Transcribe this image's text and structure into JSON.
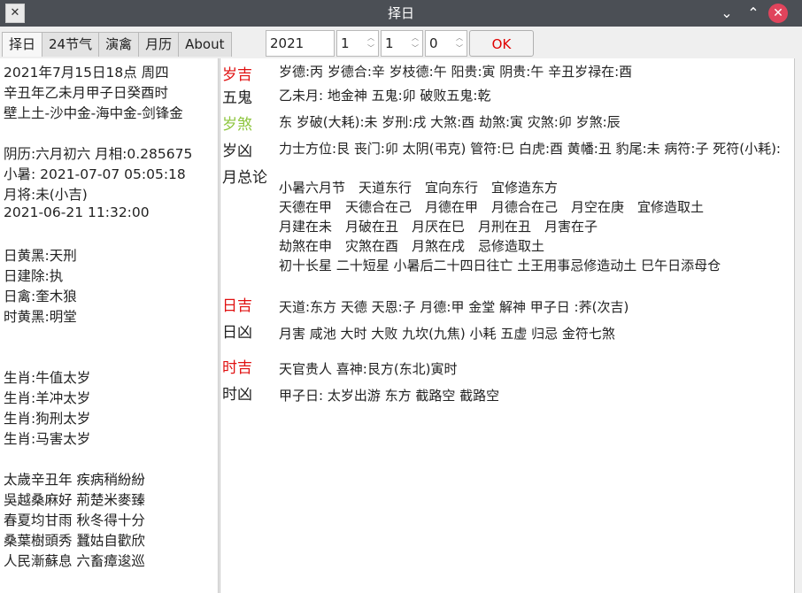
{
  "window": {
    "title": "择日",
    "icon": "app-icon",
    "controls": [
      "chevron-down-icon",
      "chevron-up-icon",
      "close-icon"
    ]
  },
  "tabs": [
    "择日",
    "24节气",
    "演禽",
    "月历",
    "About"
  ],
  "inputs": {
    "year": "2021",
    "month": "1",
    "day": "1",
    "hour": "0"
  },
  "ok_label": "OK",
  "left": {
    "lines": [
      "2021年7月15日18点 周四",
      "辛丑年乙未月甲子日癸酉时",
      "壁上土-沙中金-海中金-剑锋金",
      "",
      "阴历:六月初六 月相:0.285675",
      "小暑: 2021-07-07 05:05:18",
      "月将:未(小吉)",
      "2021-06-21 11:32:00",
      "",
      "日黄黑:天刑",
      "日建除:执",
      "日禽:奎木狼",
      "时黄黑:明堂",
      "",
      "",
      "生肖:牛值太岁",
      "生肖:羊冲太岁",
      "生肖:狗刑太岁",
      "生肖:马害太岁",
      "",
      "太歲辛丑年 疾病稍紛紛",
      "吳越桑麻好 荊楚米麥臻",
      "春夏均甘雨 秋冬得十分",
      "桑葉樹頭秀 蠶姑自歡欣",
      "人民漸蘇息 六畜瘴逡巡"
    ]
  },
  "right": {
    "suiji": {
      "label": "岁吉",
      "value": "岁德:丙 岁德合:辛 岁枝德:午 阳贵:寅 阴贵:午 辛丑岁禄在:酉"
    },
    "wugui": {
      "label": "五鬼",
      "value": "乙未月: 地金神 五鬼:卯 破败五鬼:乾"
    },
    "suisha": {
      "label": "岁煞",
      "value": "东 岁破(大耗):未 岁刑:戌 大煞:酉 劫煞:寅 灾煞:卯 岁煞:辰"
    },
    "suixiong": {
      "label": "岁凶",
      "value": "力士方位:艮 丧门:卯 太阴(弔克) 管符:巳 白虎:酉 黄幡:丑 豹尾:未 病符:子 死符(小耗):"
    },
    "yuezonglun": {
      "label": "月总论",
      "lines": [
        "小暑六月节　天道东行　宜向东行　宜修造东方",
        "天德在甲　天德合在己　月德在甲　月德合在己　月空在庚　宜修造取土",
        "月建在未　月破在丑　月厌在巳　月刑在丑　月害在子",
        "劫煞在申　灾煞在酉　月煞在戌　忌修造取土",
        "初十长星 二十短星 小暑后二十四日往亡 土王用事忌修造动土 巳午日添母仓"
      ]
    },
    "riji": {
      "label": "日吉",
      "value": "天道:东方 天德 天恩:子 月德:甲 金堂 解神 甲子日 :荞(次吉)"
    },
    "rixiong": {
      "label": "日凶",
      "value": "月害 咸池 大时 大败 九坎(九焦) 小耗 五虚 归忌 金符七煞"
    },
    "shiji": {
      "label": "时吉",
      "value": "天官贵人 喜神:艮方(东北)寅时"
    },
    "shixiong": {
      "label": "时凶",
      "value": "甲子日: 太岁出游 东方 截路空 截路空"
    }
  },
  "colors": {
    "red_label": "#e01010",
    "green_label": "#8ec63f",
    "titlebar": "#4b4f55",
    "close": "#e0445c"
  }
}
